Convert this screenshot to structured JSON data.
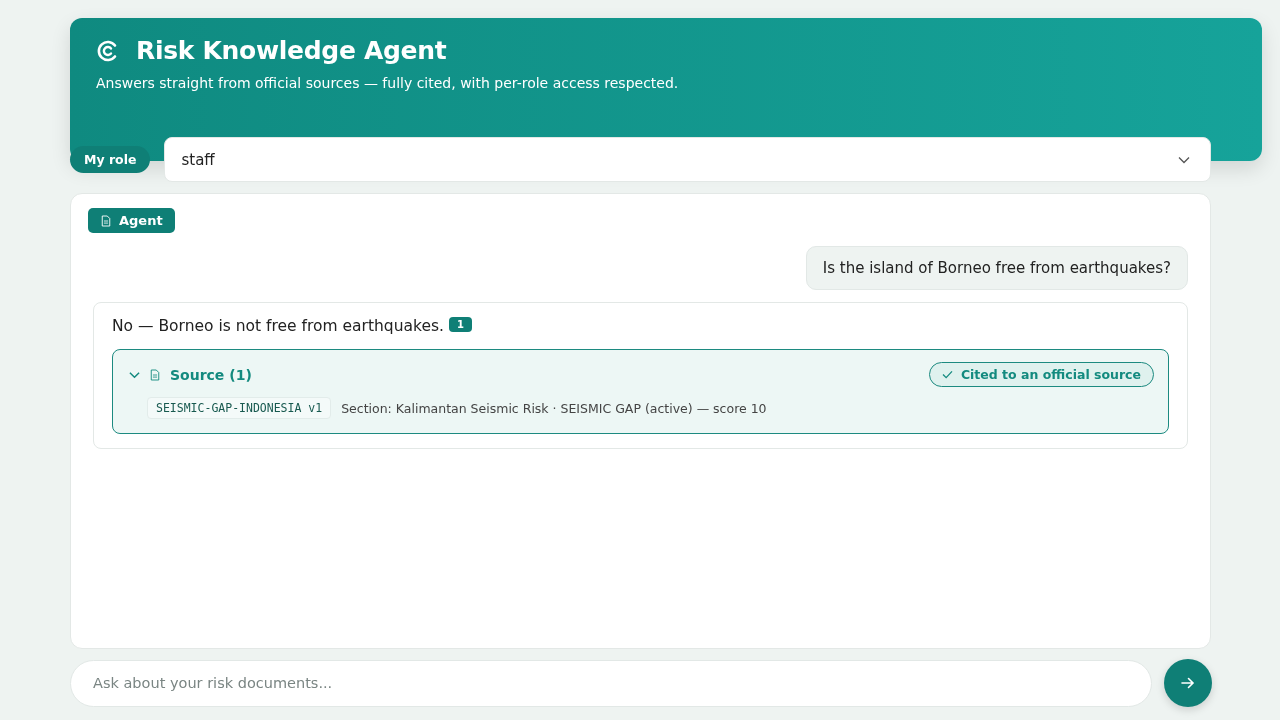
{
  "header": {
    "title": "Risk Knowledge Agent",
    "subtitle": "Answers straight from official sources — fully cited, with per-role access respected."
  },
  "role": {
    "label": "My role",
    "value": "staff"
  },
  "chat": {
    "badge": "Agent",
    "messages": [
      {
        "kind": "user",
        "text": "Is the island of Borneo free from earthquakes?"
      },
      {
        "kind": "agent",
        "text": "No — Borneo is not free from earthquakes.",
        "citation": "1",
        "sources": {
          "title": "Source (1)",
          "expanded": true,
          "verified_label": "Cited to an official source",
          "items": [
            {
              "doc": "SEISMIC-GAP-INDONESIA v1",
              "detail": "Section: Kalimantan Seismic Risk · SEISMIC GAP (active) — score 10"
            }
          ]
        }
      }
    ]
  },
  "input": {
    "placeholder": "Ask about your risk documents..."
  }
}
